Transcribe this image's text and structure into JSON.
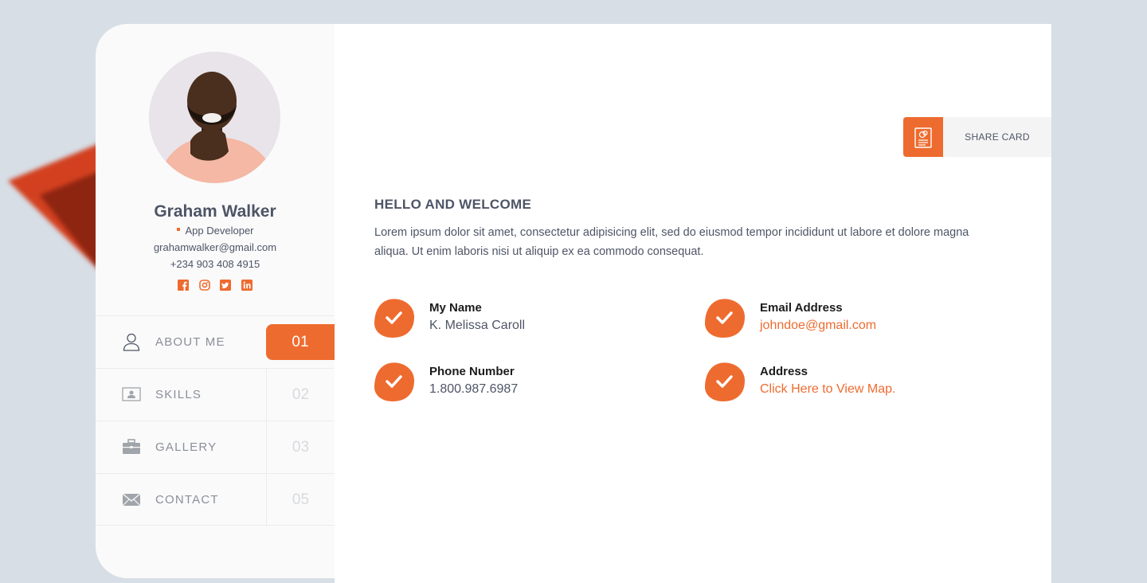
{
  "colors": {
    "accent": "#ee6b2f",
    "text": "#4d5566",
    "background": "#d7dee6"
  },
  "profile": {
    "name": "Graham Walker",
    "role": "App Developer",
    "email": "grahamwalker@gmail.com",
    "phone": "+234 903 408 4915",
    "socials": [
      "facebook-icon",
      "instagram-icon",
      "twitter-icon",
      "linkedin-icon"
    ]
  },
  "nav": {
    "items": [
      {
        "label": "ABOUT ME",
        "number": "01",
        "icon": "user-icon",
        "active": true
      },
      {
        "label": "SKILLS",
        "number": "02",
        "icon": "id-card-icon",
        "active": false
      },
      {
        "label": "GALLERY",
        "number": "03",
        "icon": "briefcase-icon",
        "active": false
      },
      {
        "label": "CONTACT",
        "number": "05",
        "icon": "envelope-icon",
        "active": false
      }
    ]
  },
  "share": {
    "label": "SHARE CARD",
    "icon": "share-card-icon"
  },
  "about": {
    "title": "HELLO AND WELCOME",
    "text": "Lorem ipsum dolor sit amet, consectetur adipisicing elit, sed do eiusmod tempor incididunt ut labore et dolore magna aliqua. Ut enim laboris nisi ut aliquip ex ea commodo consequat."
  },
  "info": [
    {
      "label": "My Name",
      "value": "K. Melissa Caroll"
    },
    {
      "label": "Email Address",
      "value": "johndoe@gmail.com"
    },
    {
      "label": "Phone Number",
      "value": "1.800.987.6987"
    },
    {
      "label": "Address",
      "value": "Click Here to View Map."
    }
  ]
}
